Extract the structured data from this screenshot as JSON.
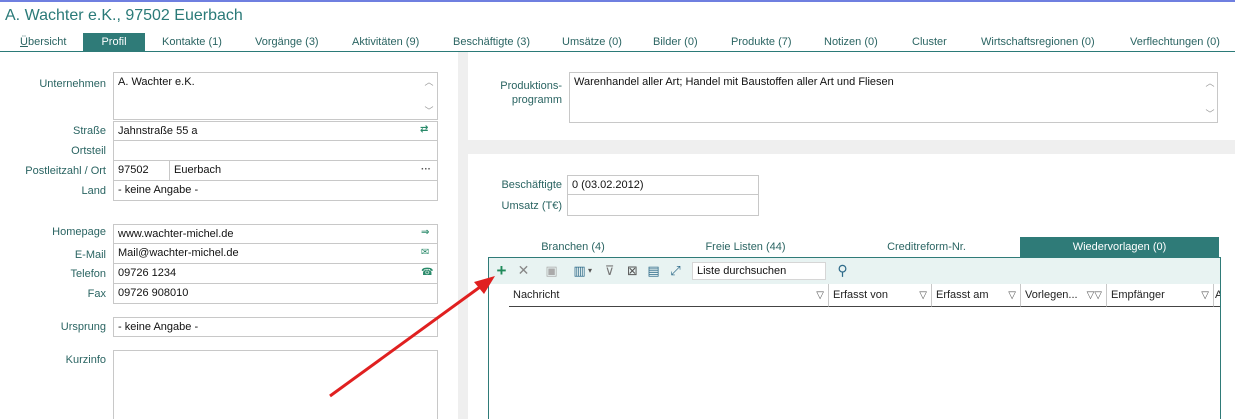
{
  "window": {
    "title": "A. Wachter e.K., 97502 Euerbach"
  },
  "tabs": [
    {
      "label": "Übersicht"
    },
    {
      "label": "Profil"
    },
    {
      "label": "Kontakte (1)"
    },
    {
      "label": "Vorgänge (3)"
    },
    {
      "label": "Aktivitäten (9)"
    },
    {
      "label": "Beschäftigte (3)"
    },
    {
      "label": "Umsätze (0)"
    },
    {
      "label": "Bilder (0)"
    },
    {
      "label": "Produkte (7)"
    },
    {
      "label": "Notizen (0)"
    },
    {
      "label": "Cluster"
    },
    {
      "label": "Wirtschaftsregionen (0)"
    },
    {
      "label": "Verflechtungen (0)"
    }
  ],
  "profile": {
    "unternehmen_label": "Unternehmen",
    "unternehmen_value": "A. Wachter e.K.",
    "strasse_label": "Straße",
    "strasse_value": "Jahnstraße 55 a",
    "ortsteil_label": "Ortsteil",
    "ortsteil_value": "",
    "plz_ort_label": "Postleitzahl / Ort",
    "plz_value": "97502",
    "ort_value": "Euerbach",
    "land_label": "Land",
    "land_value": "- keine Angabe -",
    "homepage_label": "Homepage",
    "homepage_value": "www.wachter-michel.de",
    "email_label": "E-Mail",
    "email_value": "Mail@wachter-michel.de",
    "telefon_label": "Telefon",
    "telefon_value": "09726 1234",
    "fax_label": "Fax",
    "fax_value": "09726 908010",
    "ursprung_label": "Ursprung",
    "ursprung_value": " - keine Angabe -",
    "kurzinfo_label": "Kurzinfo",
    "kurzinfo_value": ""
  },
  "produktion": {
    "label_line1": "Produktions-",
    "label_line2": "programm",
    "value": "Warenhandel aller Art; Handel mit Baustoffen aller Art und Fliesen"
  },
  "stats": {
    "beschaeftigte_label": "Beschäftigte",
    "beschaeftigte_value": "0  (03.02.2012)",
    "umsatz_label": "Umsatz (T€)",
    "umsatz_value": ""
  },
  "subtabs": [
    {
      "label": "Branchen (4)"
    },
    {
      "label": "Freie Listen (44)"
    },
    {
      "label": "Creditreform-Nr."
    },
    {
      "label": "Wiedervorlagen (0)"
    }
  ],
  "grid": {
    "search_value": "Liste durchsuchen",
    "columns": [
      {
        "label": "Nachricht"
      },
      {
        "label": "Erfasst von"
      },
      {
        "label": "Erfasst am"
      },
      {
        "label": "Vorlegen..."
      },
      {
        "label": "Empfänger"
      },
      {
        "label": "A"
      }
    ],
    "rows": []
  },
  "icons": {
    "add": "plus-icon",
    "delete": "x-icon",
    "edit": "edit-icon",
    "columns": "columns-icon",
    "clear_filter": "clear-filter-icon",
    "excel": "excel-export-icon",
    "layout": "layout-icon",
    "fullscreen": "fullscreen-icon",
    "search": "magnifier-icon",
    "filter": "funnel-icon"
  },
  "colors": {
    "accent": "#2f7b78",
    "label_text": "#2a6462",
    "annotation_arrow": "#e02020"
  }
}
